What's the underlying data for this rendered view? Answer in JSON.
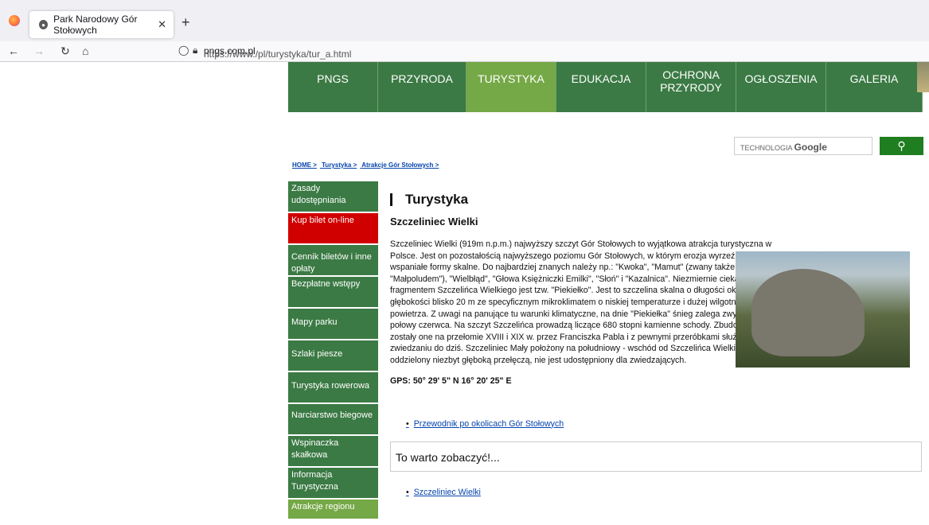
{
  "tab": {
    "title": "Park Narodowy Gór Stołowych"
  },
  "url": {
    "prefix": "https://www.",
    "domain": "pngs.com.pl",
    "path": "/pl/turystyka/tur_a.html"
  },
  "topnav": [
    "PNGS",
    "PRZYRODA",
    "TURYSTYKA",
    "EDUKACJA",
    "OCHRONA\nPRZYRODY",
    "OGŁOSZENIA",
    "GALERIA"
  ],
  "search": {
    "label_small": "TECHNOLOGIA",
    "label_brand": "Google"
  },
  "breadcrumbs": [
    "HOME >",
    "Turystyka >",
    "Atrakcje Gór Stołowych >"
  ],
  "leftnav": [
    "Zasady udostępniania",
    "Kup bilet on-line",
    "Cennik biletów i inne opłaty",
    "Bezpłatne wstępy",
    "Mapy parku",
    "Szlaki piesze",
    "Turystyka rowerowa",
    "Narciarstwo biegowe",
    "Wspinaczka skałkowa",
    "Informacja Turystyczna",
    "Atrakcje regionu"
  ],
  "content": {
    "heading": "Turystyka",
    "subheading": "Szczeliniec Wielki",
    "paragraph": "Szczeliniec Wielki (919m n.p.m.) najwyższy szczyt Gór Stołowych to wyjątkowa atrakcja turystyczna w Polsce. Jest on pozostałością najwyższego poziomu Gór Stołowych, w którym erozja wyrzeźbiła wspaniałe formy skalne. Do najbardziej znanych należy np.: \"Kwoka\", \"Mamut\" (zwany także \"Małpoludem\"), \"Wielbłąd\", \"Głowa Księżniczki Emilki\", \"Słoń\" i \"Kazalnica\". Niezmiernie ciekawym fragmentem Szczelińca Wielkiego jest tzw. \"Piekiełko\". Jest to szczelina skalna o długości ok. 100 m i głębokości blisko 20 m ze specyficznym mikroklimatem o niskiej temperaturze i dużej wilgotności powietrza. Z uwagi na panujące tu warunki klimatyczne, na dnie \"Piekiełka\" śnieg zalega zwykle do połowy czerwca. Na szczyt Szczelińca prowadzą liczące 680 stopni kamienne schody. Zbudowane zostały one na przełomie XVIII i XIX w. przez Franciszka Pabla i z pewnymi przeróbkami służą zwiedzaniu do dziś. Szczeliniec Mały położony na południowy - wschód od Szczelińca Wielkiego i oddzielony niezbyt głęboką przełęczą, nie jest udostępniony dla zwiedzających.",
    "gps": "GPS: 50° 29' 5\" N 16° 20' 25\" E",
    "link1": "Przewodnik po okolicach Gór Stołowych",
    "box_title": "To warto zobaczyć!...",
    "link2": "Szczeliniec Wielki"
  }
}
